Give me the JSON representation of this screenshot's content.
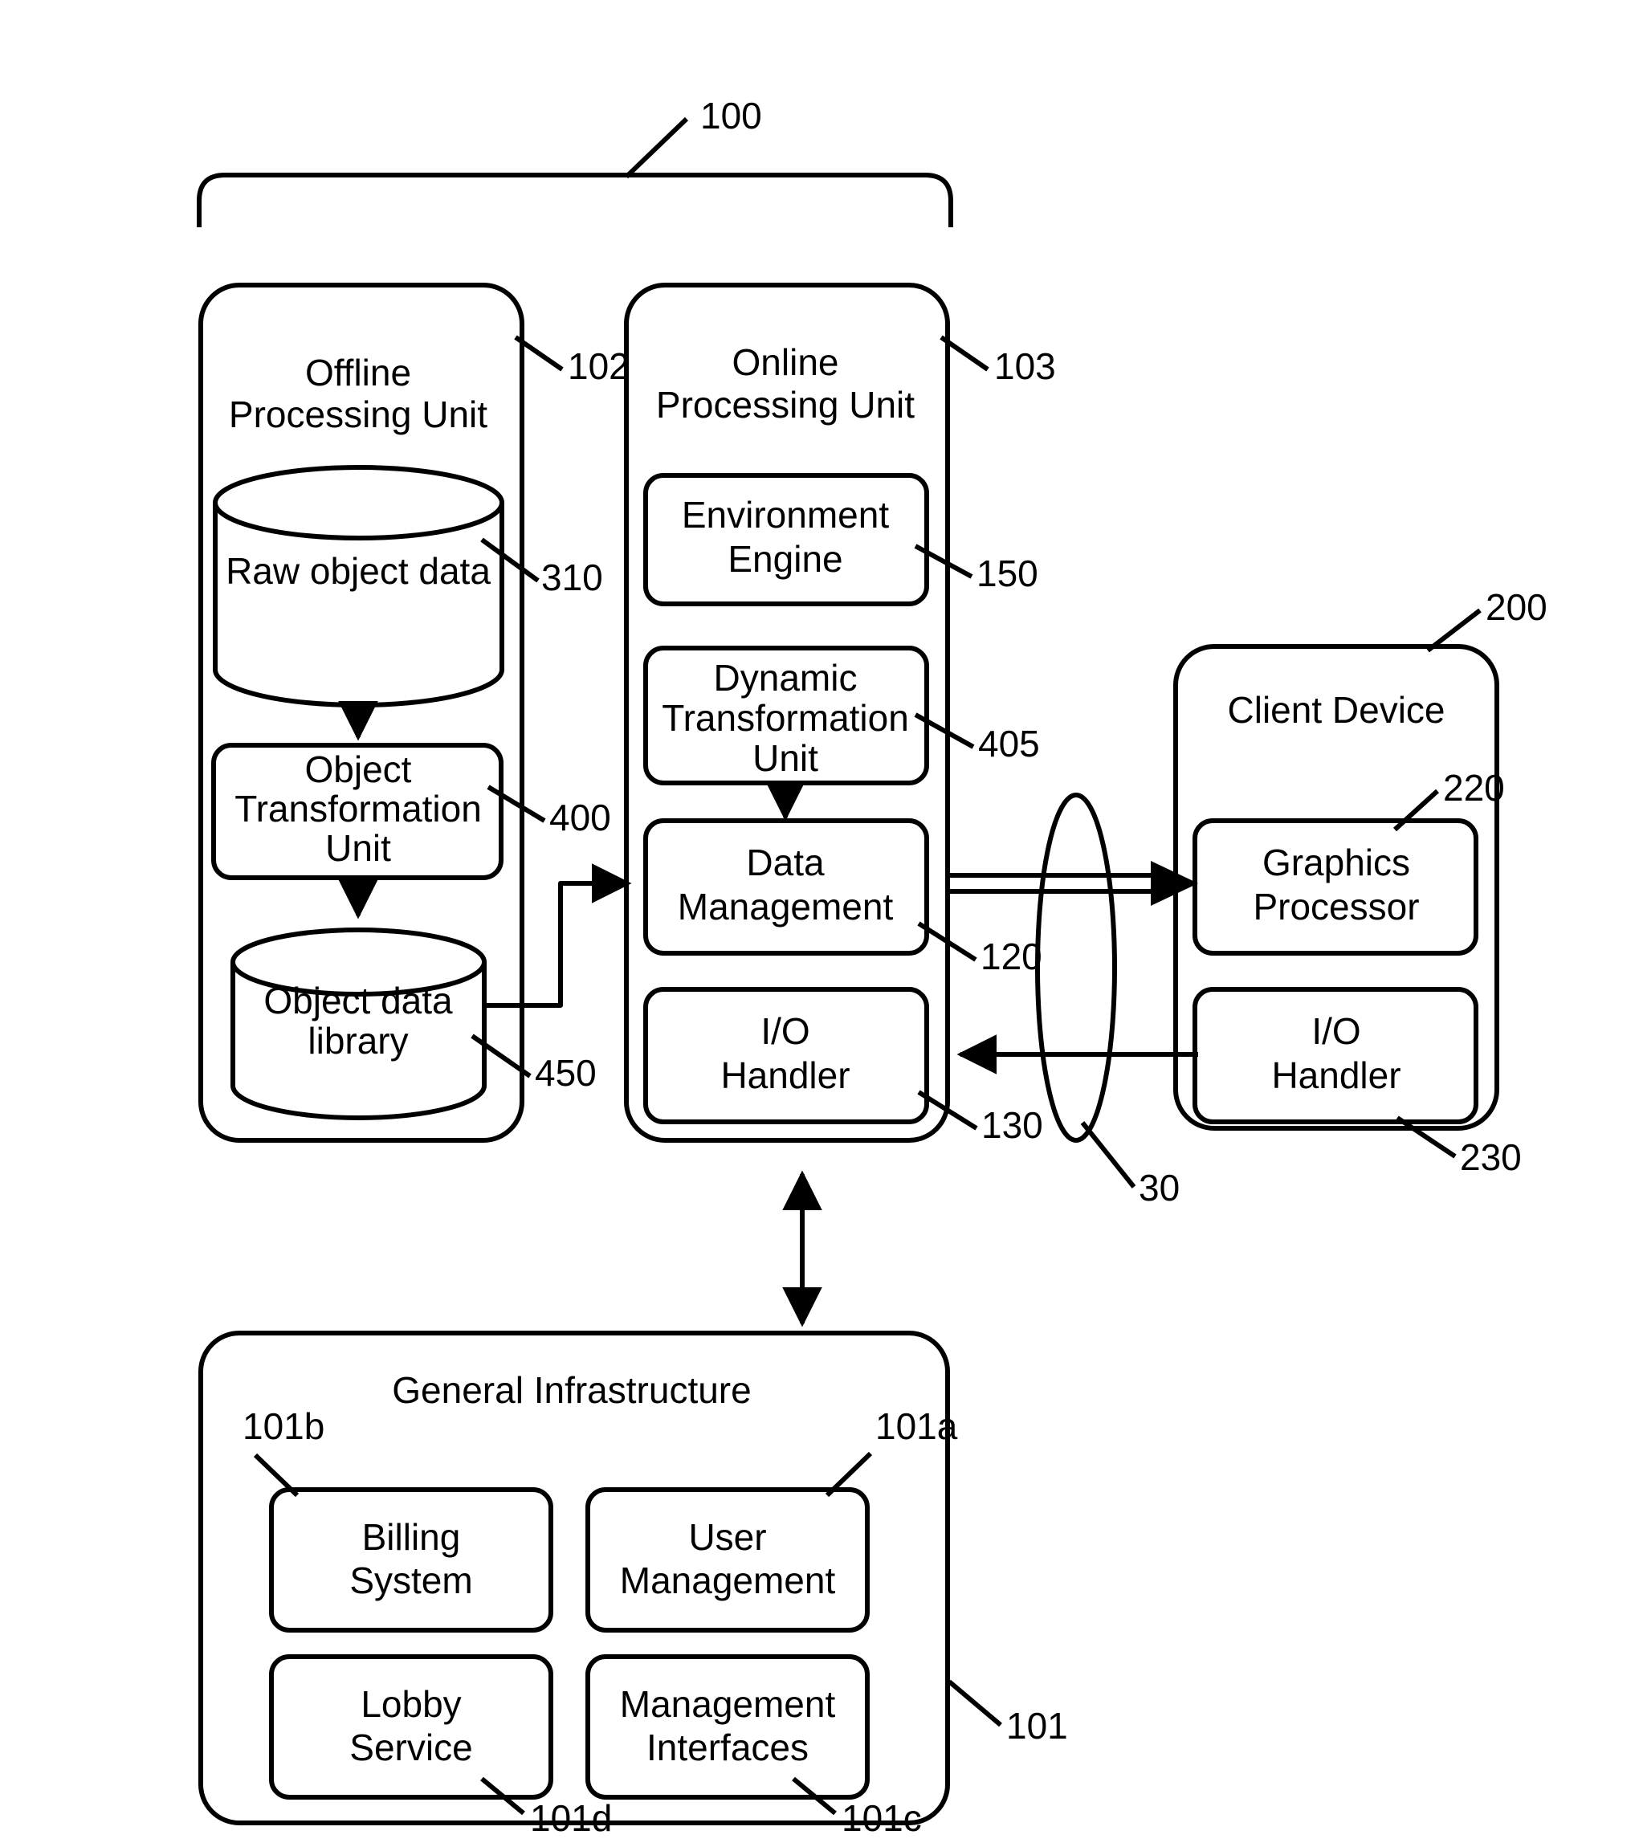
{
  "figure": {
    "title_ref": "100",
    "background_color": "#ffffff",
    "stroke_color": "#000000"
  },
  "system": {
    "ref": "100"
  },
  "offline_unit": {
    "title_line1": "Offline",
    "title_line2": "Processing Unit",
    "ref": "102",
    "raw_object_data": {
      "label": "Raw object data",
      "ref": "310"
    },
    "object_transformation_unit": {
      "line1": "Object",
      "line2": "Transformation",
      "line3": "Unit",
      "ref": "400"
    },
    "object_data_library": {
      "line1": "Object data",
      "line2": "library",
      "ref": "450"
    }
  },
  "online_unit": {
    "title_line1": "Online",
    "title_line2": "Processing Unit",
    "ref": "103",
    "environment_engine": {
      "line1": "Environment",
      "line2": "Engine",
      "ref": "150"
    },
    "dynamic_transformation_unit": {
      "line1": "Dynamic",
      "line2": "Transformation",
      "line3": "Unit",
      "ref": "405"
    },
    "data_management": {
      "line1": "Data",
      "line2": "Management",
      "ref": "120"
    },
    "io_handler": {
      "line1": "I/O",
      "line2": "Handler",
      "ref": "130"
    }
  },
  "network": {
    "ref": "30"
  },
  "client_device": {
    "title": "Client Device",
    "ref": "200",
    "graphics_processor": {
      "line1": "Graphics",
      "line2": "Processor",
      "ref": "220"
    },
    "io_handler": {
      "line1": "I/O",
      "line2": "Handler",
      "ref": "230"
    }
  },
  "general_infrastructure": {
    "title": "General Infrastructure",
    "ref": "101",
    "billing_system": {
      "line1": "Billing",
      "line2": "System",
      "ref": "101b"
    },
    "user_management": {
      "line1": "User",
      "line2": "Management",
      "ref": "101a"
    },
    "lobby_service": {
      "line1": "Lobby",
      "line2": "Service",
      "ref": "101d"
    },
    "management_interfaces": {
      "line1": "Management",
      "line2": "Interfaces",
      "ref": "101c"
    }
  }
}
